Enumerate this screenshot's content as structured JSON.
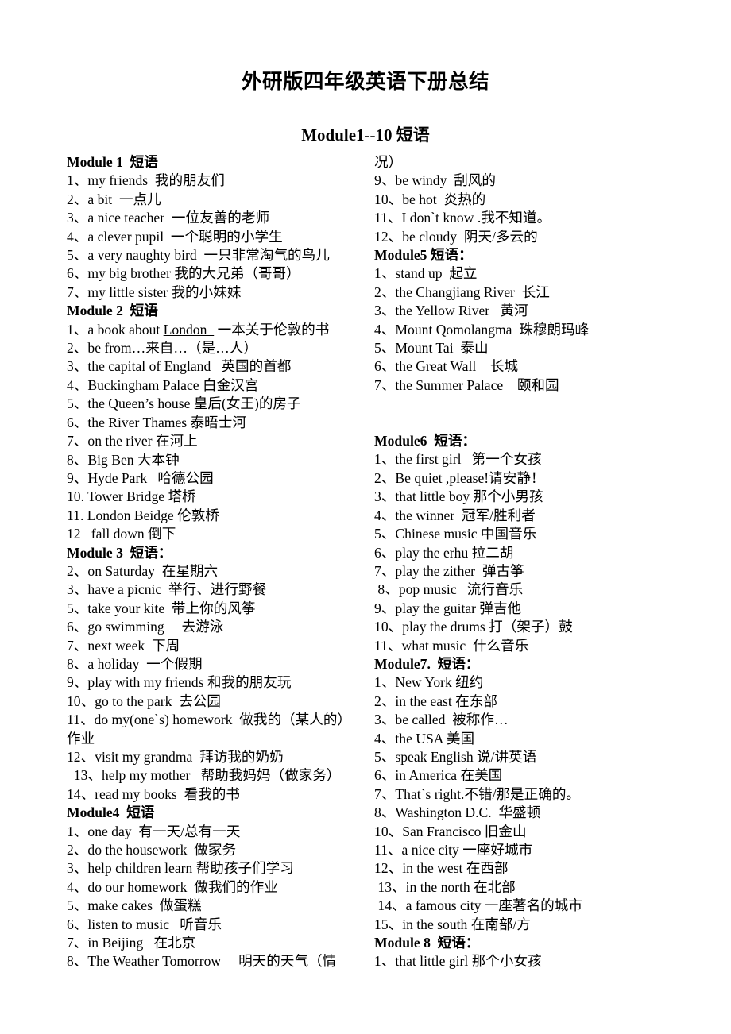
{
  "document": {
    "title": "外研版四年级英语下册总结",
    "section_title": "Module1--10 短语"
  },
  "left_column": {
    "lines": [
      {
        "id": "m1-head",
        "text": "Module 1  短语",
        "bold": true
      },
      {
        "id": "m1-1",
        "text": "1、my friends  我的朋友们"
      },
      {
        "id": "m1-2",
        "text": "2、a bit  一点儿"
      },
      {
        "id": "m1-3",
        "text": "3、a nice teacher  一位友善的老师"
      },
      {
        "id": "m1-4",
        "text": "4、a clever pupil  一个聪明的小学生"
      },
      {
        "id": "m1-5",
        "text": "5、a very naughty bird  一只非常淘气的鸟儿"
      },
      {
        "id": "m1-6",
        "text": "6、my big brother 我的大兄弟（哥哥）"
      },
      {
        "id": "m1-7",
        "text": "7、my little sister 我的小妹妹"
      },
      {
        "id": "m2-head",
        "text": "Module 2  短语",
        "bold": true
      },
      {
        "id": "m2-1",
        "text": "1、a book about ",
        "underline": "London  ",
        "tail": " 一本关于伦敦的书"
      },
      {
        "id": "m2-2",
        "text": "2、be from…来自…（是…人）"
      },
      {
        "id": "m2-3",
        "text": "3、the capital of ",
        "underline": "England  ",
        "tail": " 英国的首都"
      },
      {
        "id": "m2-4",
        "text": "4、Buckingham Palace 白金汉宫"
      },
      {
        "id": "m2-5",
        "text": "5、the Queen’s house 皇后(女王)的房子"
      },
      {
        "id": "m2-6",
        "text": "6、the River Thames 泰晤士河"
      },
      {
        "id": "m2-7",
        "text": "7、on the river 在河上"
      },
      {
        "id": "m2-8",
        "text": "8、Big Ben 大本钟"
      },
      {
        "id": "m2-9",
        "text": "9、Hyde Park   哈德公园"
      },
      {
        "id": "m2-10",
        "text": "10. Tower Bridge 塔桥"
      },
      {
        "id": "m2-11",
        "text": "11. London Beidge 伦敦桥"
      },
      {
        "id": "m2-12",
        "text": "12   fall down 倒下"
      },
      {
        "id": "m3-head",
        "text": "Module 3  短语：",
        "bold": true
      },
      {
        "id": "m3-2",
        "text": "2、on Saturday  在星期六"
      },
      {
        "id": "m3-3",
        "text": "3、have a picnic  举行、进行野餐"
      },
      {
        "id": "m3-5",
        "text": "5、take your kite  带上你的风筝"
      },
      {
        "id": "m3-6",
        "text": "6、go swimming     去游泳"
      },
      {
        "id": "m3-7",
        "text": "7、next week  下周"
      },
      {
        "id": "m3-8",
        "text": "8、a holiday  一个假期"
      },
      {
        "id": "m3-9",
        "text": "9、play with my friends 和我的朋友玩"
      },
      {
        "id": "m3-10",
        "text": "10、go to the park  去公园"
      },
      {
        "id": "m3-11",
        "text": "11、do my(one`s) homework  做我的（某人的）"
      },
      {
        "id": "m3-11b",
        "text": "作业"
      },
      {
        "id": "m3-12",
        "text": "12、visit my grandma  拜访我的奶奶"
      },
      {
        "id": "m3-13",
        "text": "  13、help my mother   帮助我妈妈（做家务）"
      },
      {
        "id": "m3-14",
        "text": "14、read my books  看我的书"
      },
      {
        "id": "m4-head",
        "text": "Module4  短语",
        "bold": true
      },
      {
        "id": "m4-1",
        "text": "1、one day  有一天/总有一天"
      },
      {
        "id": "m4-2",
        "text": "2、do the housework  做家务"
      },
      {
        "id": "m4-3",
        "text": "3、help children learn 帮助孩子们学习"
      },
      {
        "id": "m4-4",
        "text": "4、do our homework  做我们的作业"
      },
      {
        "id": "m4-5",
        "text": "5、make cakes  做蛋糕"
      },
      {
        "id": "m4-6",
        "text": "6、listen to music   听音乐"
      },
      {
        "id": "m4-7",
        "text": "7、in Beijing   在北京"
      },
      {
        "id": "m4-8",
        "text": "8、The Weather Tomorrow     明天的天气（情"
      }
    ]
  },
  "right_column": {
    "lines": [
      {
        "id": "r-cont",
        "text": "况）"
      },
      {
        "id": "m4-9",
        "text": "9、be windy  刮风的"
      },
      {
        "id": "m4-10",
        "text": "10、be hot  炎热的"
      },
      {
        "id": "m4-11",
        "text": "11、I don`t know .我不知道。"
      },
      {
        "id": "m4-12",
        "text": "12、be cloudy  阴天/多云的"
      },
      {
        "id": "m5-head",
        "text": "Module5 短语：",
        "bold": true
      },
      {
        "id": "m5-1",
        "text": "1、stand up  起立"
      },
      {
        "id": "m5-2",
        "text": "2、the Changjiang River  长江"
      },
      {
        "id": "m5-3",
        "text": "3、the Yellow River   黄河"
      },
      {
        "id": "m5-4",
        "text": "4、Mount Qomolangma  珠穆朗玛峰"
      },
      {
        "id": "m5-5",
        "text": "5、Mount Tai  泰山"
      },
      {
        "id": "m5-6",
        "text": "6、the Great Wall    长城"
      },
      {
        "id": "m5-7",
        "text": "7、the Summer Palace    颐和园"
      },
      {
        "id": "gap-1",
        "text": "",
        "blank": true
      },
      {
        "id": "gap-2",
        "text": "",
        "blank": true
      },
      {
        "id": "m6-head",
        "text": "Module6  短语：",
        "bold": true
      },
      {
        "id": "m6-1",
        "text": "1、the first girl   第一个女孩"
      },
      {
        "id": "m6-2",
        "text": "2、Be quiet ,please!请安静！"
      },
      {
        "id": "m6-3",
        "text": "3、that little boy 那个小男孩"
      },
      {
        "id": "m6-4",
        "text": "4、the winner  冠军/胜利者"
      },
      {
        "id": "m6-5",
        "text": "5、Chinese music 中国音乐"
      },
      {
        "id": "m6-6",
        "text": "6、play the erhu 拉二胡"
      },
      {
        "id": "m6-7",
        "text": "7、play the zither  弹古筝"
      },
      {
        "id": "m6-8",
        "text": " 8、pop music   流行音乐"
      },
      {
        "id": "m6-9",
        "text": "9、play the guitar 弹吉他"
      },
      {
        "id": "m6-10",
        "text": "10、play the drums 打（架子）鼓"
      },
      {
        "id": "m6-11",
        "text": "11、what music  什么音乐"
      },
      {
        "id": "m7-head",
        "text": "Module7.  短语：",
        "bold": true
      },
      {
        "id": "m7-1",
        "text": "1、New York 纽约"
      },
      {
        "id": "m7-2",
        "text": "2、in the east 在东部"
      },
      {
        "id": "m7-3",
        "text": "3、be called  被称作…"
      },
      {
        "id": "m7-4",
        "text": "4、the USA 美国"
      },
      {
        "id": "m7-5",
        "text": "5、speak English 说/讲英语"
      },
      {
        "id": "m7-6",
        "text": "6、in America 在美国"
      },
      {
        "id": "m7-7",
        "text": "7、That`s right.不错/那是正确的。"
      },
      {
        "id": "m7-8",
        "text": "8、Washington D.C.  华盛顿"
      },
      {
        "id": "m7-10",
        "text": "10、San Francisco 旧金山"
      },
      {
        "id": "m7-11",
        "text": "11、a nice city 一座好城市"
      },
      {
        "id": "m7-12",
        "text": "12、in the west 在西部"
      },
      {
        "id": "m7-13",
        "text": " 13、in the north 在北部"
      },
      {
        "id": "m7-14",
        "text": " 14、a famous city 一座著名的城市"
      },
      {
        "id": "m7-15",
        "text": "15、in the south 在南部/方"
      },
      {
        "id": "m8-head",
        "text": "Module 8  短语：",
        "bold": true
      },
      {
        "id": "m8-1",
        "text": "1、that little girl 那个小女孩"
      }
    ]
  }
}
